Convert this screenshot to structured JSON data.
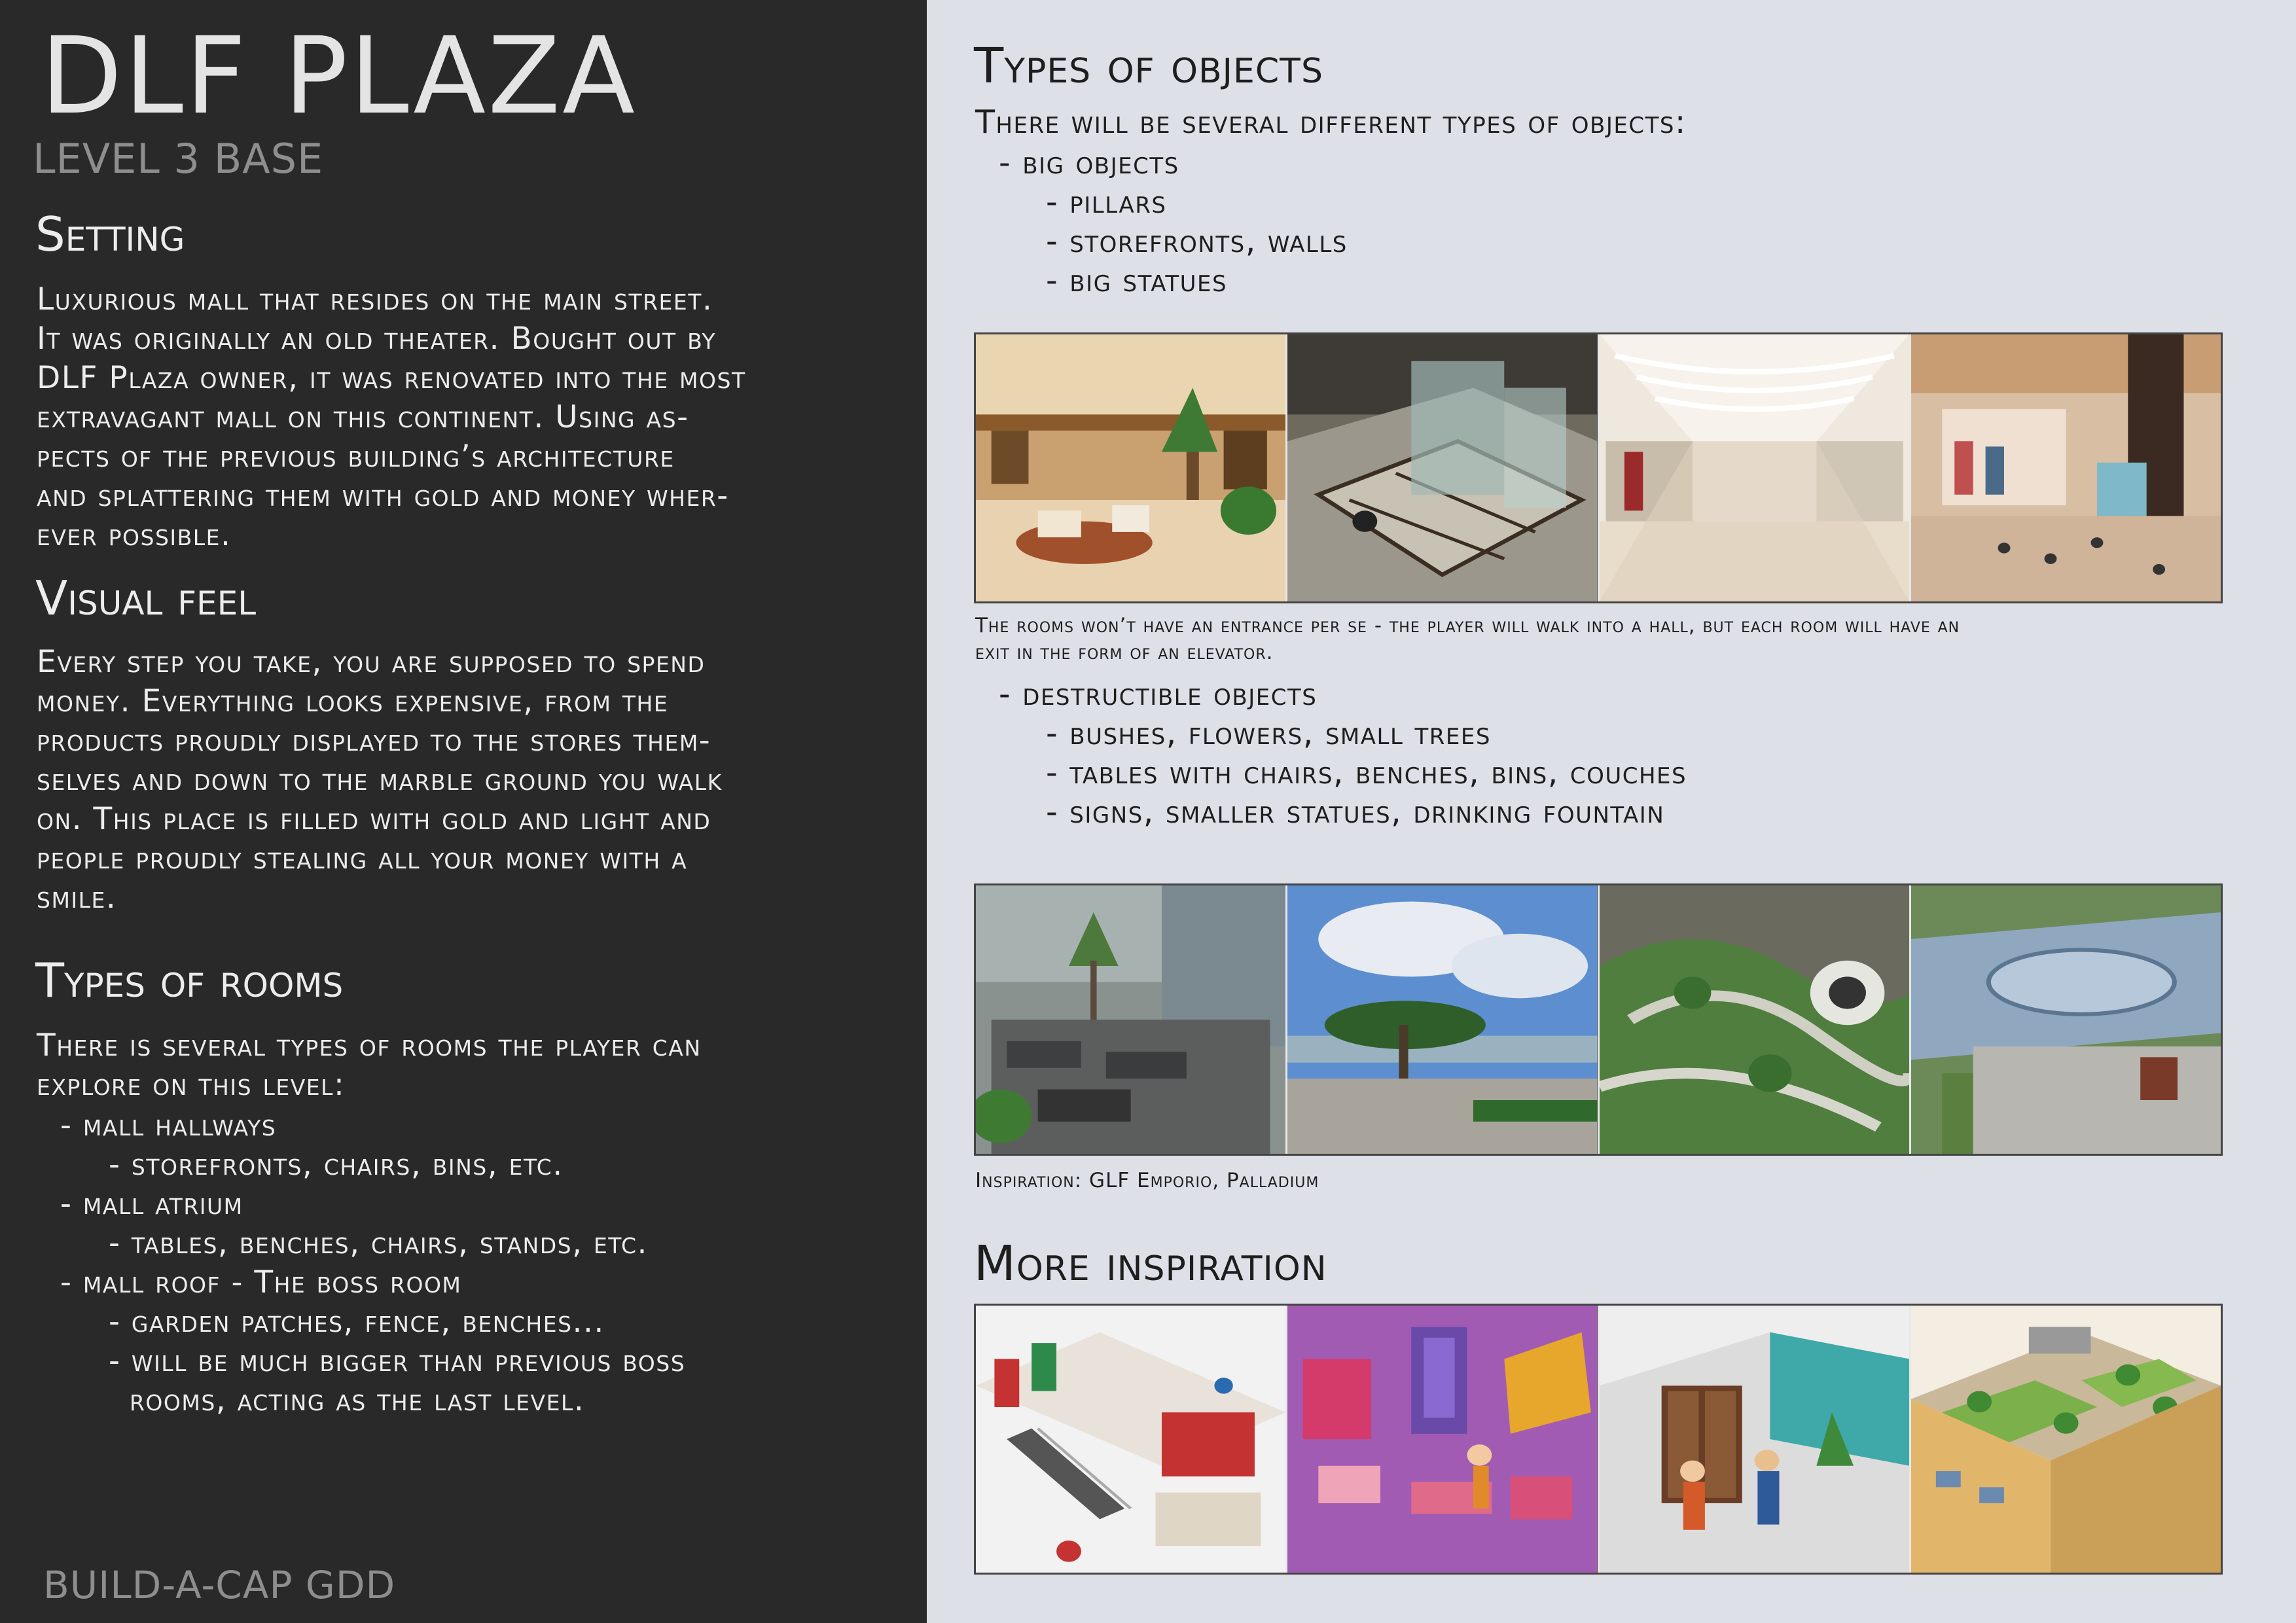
{
  "left": {
    "title": "DLF PLAZA",
    "subtitle": "LEVEL 3 BASE",
    "setting": {
      "heading": "Setting",
      "lines": [
        "Luxurious mall that resides on the main street.",
        "It was originally an old theater. Bought out by",
        "DLF Plaza owner, it was renovated into the most",
        "extravagant mall on this continent. Using as-",
        "pects of the previous building’s architecture",
        "and splattering them with gold and money wher-",
        "ever possible."
      ]
    },
    "visual": {
      "heading": "Visual feel",
      "lines": [
        "Every step you take, you are supposed to spend",
        "money. Everything looks expensive, from the",
        "products proudly displayed to the stores them-",
        "selves and down to the marble ground you walk",
        "on. This place is filled with gold and light and",
        "people proudly stealing all your money with a",
        "smile."
      ]
    },
    "rooms": {
      "heading": "Types of rooms",
      "intro": [
        "There is several types of rooms the player can",
        "explore on this level:"
      ],
      "items": [
        "- mall hallways",
        "- storefronts, chairs, bins, etc.",
        "- mall atrium",
        "- tables, benches, chairs, stands, etc.",
        "- mall roof - The boss room",
        "- garden patches, fence, benches...",
        "- will be much bigger than previous boss",
        "rooms, acting as the last level."
      ]
    },
    "footer": "BUILD-A-CAP GDD"
  },
  "right": {
    "objects": {
      "heading": "Types of objects",
      "intro": "There will be several different types of objects:",
      "big": "- big objects",
      "big_items": [
        "- pillars",
        "- storefronts, walls",
        "- big statues"
      ],
      "caption": [
        "The rooms won’t have an entrance per se - the player will walk into a hall, but each room will have an",
        "exit in the form of an elevator."
      ],
      "destructible": "- destructible objects",
      "destructible_items": [
        "- bushes, flowers, small trees",
        "- tables with chairs, benches, bins, couches",
        "- signs, smaller statues, drinking fountain"
      ],
      "caption2": "Inspiration: GLF Emporio, Palladium"
    },
    "more": {
      "heading": "More inspiration"
    }
  },
  "images": {
    "row1": [
      "mall-interior-lobby-photo",
      "mall-glass-elevator-photo",
      "mall-white-hallway-photo",
      "mall-atrium-store-photo"
    ],
    "row2": [
      "mall-terrace-lounge-photo",
      "rooftop-garden-sky-photo",
      "rooftop-garden-aerial-photo",
      "mall-glass-roof-aerial-photo"
    ],
    "row3": [
      "isometric-mall-escalator-illustration",
      "isometric-sale-shop-illustration",
      "isometric-elevator-door-illustration",
      "isometric-rooftop-garden-illustration"
    ]
  },
  "colors": {
    "left_bg": "#292929",
    "right_bg": "#dde0e6",
    "text_light": "#ececec",
    "text_dark": "#1e1e1e",
    "muted": "#8e8e8e"
  }
}
